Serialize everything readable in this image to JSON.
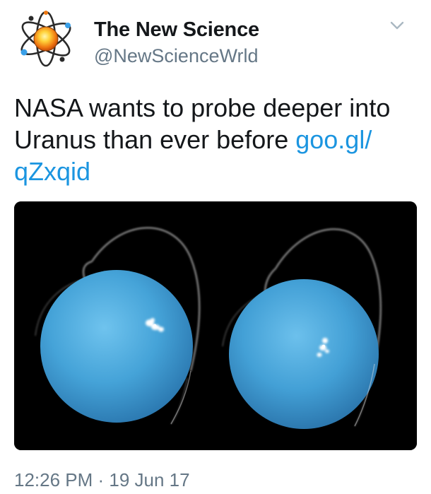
{
  "author": {
    "name": "The New Science",
    "handle": "@NewScienceWrld",
    "avatar_icon": "atom-logo-icon"
  },
  "menu": {
    "icon": "chevron-down-icon"
  },
  "tweet": {
    "text": "NASA wants to probe deeper into Uranus than ever before ",
    "link_line1": "goo.gl/",
    "link_line2": "qZxqid"
  },
  "media": {
    "description_icon": "uranus-aurora-photo",
    "planet_color": "#4aa8dc"
  },
  "timestamp": "12:26 PM · 19 Jun 17",
  "colors": {
    "link": "#1b95e0",
    "secondary_text": "#657786",
    "primary_text": "#14171a"
  }
}
